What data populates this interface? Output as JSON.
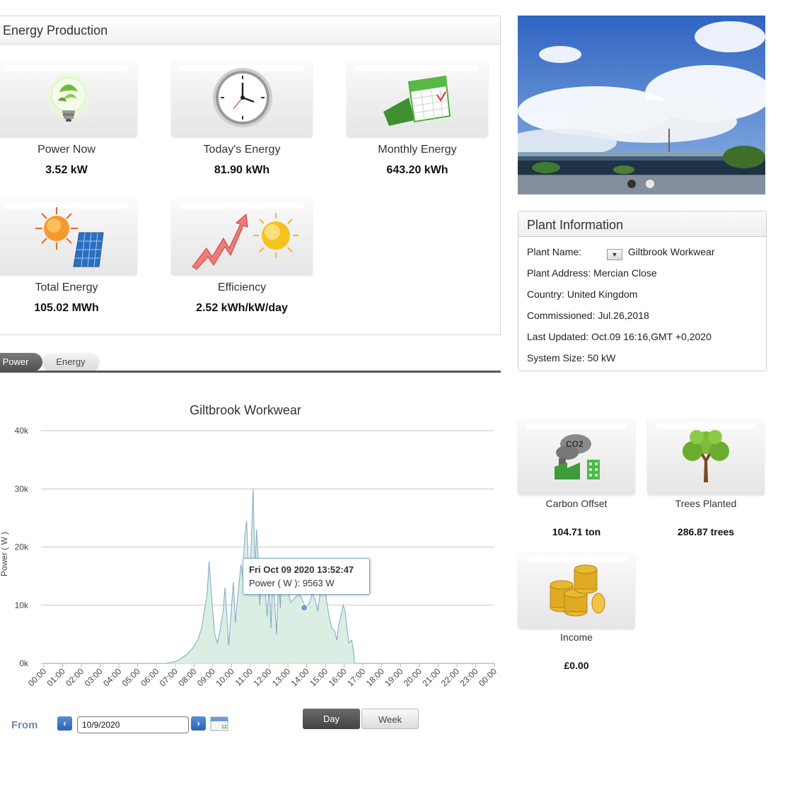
{
  "energy_production": {
    "title": "Energy Production",
    "tiles": [
      {
        "label": "Power Now",
        "value": "3.52 kW",
        "icon": "lightbulb-leaf-icon"
      },
      {
        "label": "Today's Energy",
        "value": "81.90 kWh",
        "icon": "clock-icon"
      },
      {
        "label": "Monthly Energy",
        "value": "643.20 kWh",
        "icon": "calendar-icon"
      },
      {
        "label": "Total Energy",
        "value": "105.02 MWh",
        "icon": "sun-solar-panel-icon"
      },
      {
        "label": "Efficiency",
        "value": "2.52 kWh/kW/day",
        "icon": "chart-arrow-sun-icon"
      }
    ]
  },
  "tabs": {
    "power": "Power",
    "energy": "Energy",
    "active": "Power"
  },
  "photo": {
    "slides": 2,
    "active_slide": 1
  },
  "plant_info": {
    "title": "Plant Information",
    "rows": [
      {
        "label": "Plant Name:",
        "value": "Giltbrook Workwear"
      },
      {
        "label": "Plant Address:",
        "value": "Mercian Close"
      },
      {
        "label": "Country:",
        "value": "United Kingdom"
      },
      {
        "label": "Commissioned:",
        "value": "Jul.26,2018"
      },
      {
        "label": "Last Updated:",
        "value": "Oct.09 16:16,GMT +0,2020"
      },
      {
        "label": "System Size:",
        "value": "50 kW"
      }
    ]
  },
  "environment": [
    {
      "label": "Carbon Offset",
      "value": "104.71 ton",
      "icon": "co2-factory-icon"
    },
    {
      "label": "Trees Planted",
      "value": "286.87 trees",
      "icon": "tree-icon"
    },
    {
      "label": "Income",
      "value": "£0.00",
      "icon": "coins-icon"
    }
  ],
  "chart_data": {
    "type": "area",
    "title": "Giltbrook Workwear",
    "ylabel": "Power ( W )",
    "xlabel": "",
    "ylim": [
      0,
      40000
    ],
    "yticks": [
      "0k",
      "10k",
      "20k",
      "30k",
      "40k"
    ],
    "xticks": [
      "00:00",
      "01:00",
      "02:00",
      "03:00",
      "04:00",
      "05:00",
      "06:00",
      "07:00",
      "08:00",
      "09:00",
      "10:00",
      "11:00",
      "12:00",
      "13:00",
      "14:00",
      "15:00",
      "16:00",
      "17:00",
      "18:00",
      "19:00",
      "20:00",
      "21:00",
      "22:00",
      "23:00",
      "00:00"
    ],
    "grid": true,
    "series": [
      {
        "values_x_hours": [
          0,
          6.5,
          7.0,
          7.3,
          7.6,
          7.9,
          8.2,
          8.4,
          8.55,
          8.7,
          8.8,
          8.95,
          9.1,
          9.25,
          9.4,
          9.55,
          9.65,
          9.75,
          9.85,
          10.0,
          10.1,
          10.2,
          10.35,
          10.5,
          10.6,
          10.7,
          10.8,
          10.88,
          10.95,
          11.05,
          11.15,
          11.25,
          11.32,
          11.4,
          11.5,
          11.6,
          11.7,
          11.8,
          11.9,
          12.0,
          12.1,
          12.2,
          12.3,
          12.4,
          12.5,
          12.6,
          12.7,
          12.85,
          13.0,
          13.15,
          13.3,
          13.45,
          13.6,
          13.75,
          13.87,
          14.0,
          14.15,
          14.3,
          14.45,
          14.6,
          14.75,
          14.9,
          15.05,
          15.2,
          15.35,
          15.5,
          15.6,
          15.7,
          15.85,
          15.95,
          16.05,
          16.15,
          16.25,
          16.4,
          16.5,
          16.55,
          24
        ],
        "values_w": [
          0,
          0,
          300,
          800,
          1500,
          2500,
          4000,
          6000,
          9000,
          12000,
          17500,
          11000,
          5000,
          3500,
          6000,
          9000,
          13000,
          8000,
          3000,
          10000,
          14000,
          7000,
          12000,
          17000,
          15000,
          22000,
          24500,
          18000,
          12000,
          21000,
          30000,
          15000,
          23000,
          19000,
          10000,
          15000,
          17000,
          12000,
          8000,
          14000,
          6000,
          17000,
          10000,
          5000,
          15000,
          9500,
          17500,
          13000,
          12500,
          10500,
          11000,
          11500,
          12000,
          11000,
          10200,
          9563,
          10500,
          12000,
          11000,
          9000,
          13000,
          14000,
          11000,
          8000,
          6000,
          5500,
          4000,
          6500,
          8500,
          10000,
          9000,
          6000,
          3500,
          4000,
          2000,
          0,
          0
        ]
      }
    ],
    "tooltip": {
      "title": "Fri Oct 09 2020 13:52:47",
      "text": "Power ( W ): 9563 W",
      "x_hours": 13.87,
      "y_w": 9563
    }
  },
  "controls": {
    "from_label": "From",
    "date_value": "10/9/2020",
    "prev_icon": "chevron-left-icon",
    "next_icon": "chevron-right-icon",
    "calendar_icon": "calendar-small-icon",
    "day_label": "Day",
    "week_label": "Week"
  },
  "colors": {
    "area_fill": "#d8ede1",
    "area_line": "#7fa6c8",
    "tooltip_border": "#7fa6c8",
    "button_blue": "#2d62b3"
  }
}
